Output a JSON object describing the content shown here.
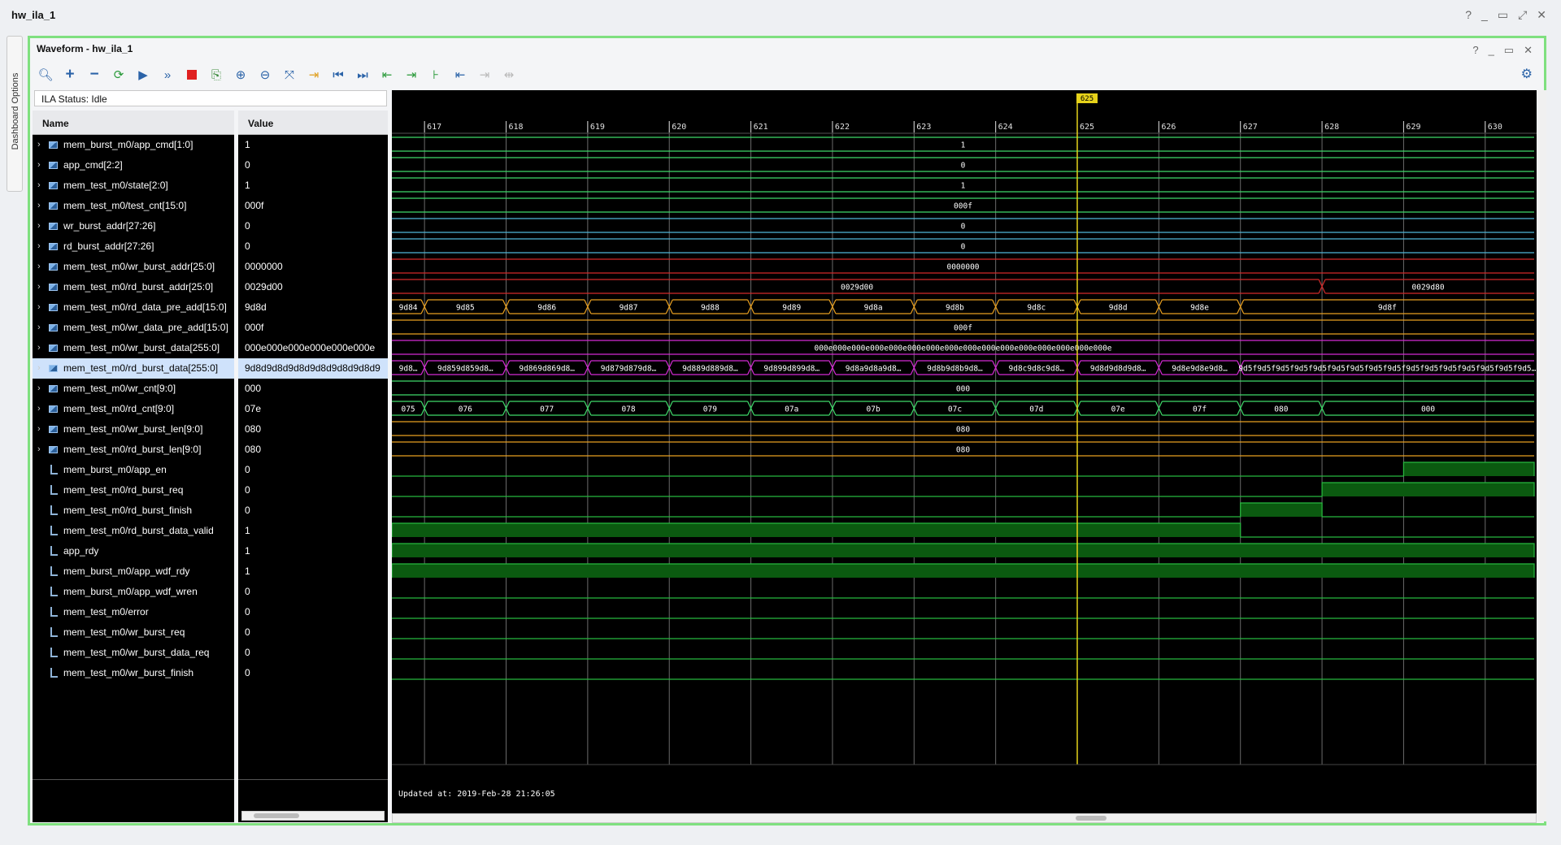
{
  "window": {
    "title": "hw_ila_1",
    "controls": [
      "?",
      "_",
      "▭",
      "⤢",
      "✕"
    ]
  },
  "dashboard_tab": "Dashboard Options",
  "panel": {
    "title": "Waveform - hw_ila_1",
    "controls": [
      "?",
      "_",
      "▭",
      "✕"
    ]
  },
  "status": "ILA Status:  Idle",
  "columns": {
    "name": "Name",
    "value": "Value"
  },
  "toolbar": [
    "search-icon",
    "add-icon",
    "remove-icon",
    "refresh-icon",
    "run-icon",
    "run-all-icon",
    "stop-icon",
    "export-icon",
    "zoom-in-icon",
    "zoom-out-icon",
    "zoom-fit-icon",
    "goto-cursor-icon",
    "goto-start-icon",
    "goto-end-icon",
    "prev-transition-icon",
    "next-transition-icon",
    "add-marker-icon",
    "prev-marker-icon",
    "next-marker-icon",
    "swap-cursor-icon"
  ],
  "cursor": {
    "time": 625,
    "label": "625"
  },
  "time_axis": {
    "ticks": [
      617,
      618,
      619,
      620,
      621,
      622,
      623,
      624,
      625,
      626,
      627,
      628,
      629,
      630
    ],
    "start": 616.6,
    "end": 630.6
  },
  "updated_text": "Updated at: 2019-Feb-28 21:26:05",
  "signals": [
    {
      "name": "mem_burst_m0/app_cmd[1:0]",
      "value": "1",
      "bus": true,
      "segments": [
        {
          "t": 616.6,
          "v": "1"
        }
      ],
      "color": "#3fd96a"
    },
    {
      "name": "app_cmd[2:2]",
      "value": "0",
      "bus": true,
      "segments": [
        {
          "t": 616.6,
          "v": "0"
        }
      ],
      "color": "#3fd96a"
    },
    {
      "name": "mem_test_m0/state[2:0]",
      "value": "1",
      "bus": true,
      "segments": [
        {
          "t": 616.6,
          "v": "1"
        }
      ],
      "color": "#3fd96a"
    },
    {
      "name": "mem_test_m0/test_cnt[15:0]",
      "value": "000f",
      "bus": true,
      "segments": [
        {
          "t": 616.6,
          "v": "000f"
        }
      ],
      "color": "#3fd96a"
    },
    {
      "name": "wr_burst_addr[27:26]",
      "value": "0",
      "bus": true,
      "segments": [
        {
          "t": 616.6,
          "v": "0"
        }
      ],
      "color": "#4fb6d8"
    },
    {
      "name": "rd_burst_addr[27:26]",
      "value": "0",
      "bus": true,
      "segments": [
        {
          "t": 616.6,
          "v": "0"
        }
      ],
      "color": "#4fb6d8"
    },
    {
      "name": "mem_test_m0/wr_burst_addr[25:0]",
      "value": "0000000",
      "bus": true,
      "segments": [
        {
          "t": 616.6,
          "v": "0000000"
        }
      ],
      "color": "#d22a2a"
    },
    {
      "name": "mem_test_m0/rd_burst_addr[25:0]",
      "value": "0029d00",
      "bus": true,
      "segments": [
        {
          "t": 616.6,
          "v": "0029d00"
        },
        {
          "t": 628,
          "v": "0029d80"
        }
      ],
      "color": "#d22a2a"
    },
    {
      "name": "mem_test_m0/rd_data_pre_add[15:0]",
      "value": "9d8d",
      "bus": true,
      "segments": [
        {
          "t": 616.6,
          "v": "9d84"
        },
        {
          "t": 617,
          "v": "9d85"
        },
        {
          "t": 618,
          "v": "9d86"
        },
        {
          "t": 619,
          "v": "9d87"
        },
        {
          "t": 620,
          "v": "9d88"
        },
        {
          "t": 621,
          "v": "9d89"
        },
        {
          "t": 622,
          "v": "9d8a"
        },
        {
          "t": 623,
          "v": "9d8b"
        },
        {
          "t": 624,
          "v": "9d8c"
        },
        {
          "t": 625,
          "v": "9d8d"
        },
        {
          "t": 626,
          "v": "9d8e"
        },
        {
          "t": 627,
          "v": "9d8f"
        }
      ],
      "color": "#e8a020"
    },
    {
      "name": "mem_test_m0/wr_data_pre_add[15:0]",
      "value": "000f",
      "bus": true,
      "segments": [
        {
          "t": 616.6,
          "v": "000f"
        }
      ],
      "color": "#e8a020"
    },
    {
      "name": "mem_test_m0/wr_burst_data[255:0]",
      "value": "000e000e000e000e000e000e",
      "bus": true,
      "segments": [
        {
          "t": 616.6,
          "v": "000e000e000e000e000e000e000e000e000e000e000e000e000e000e000e000e"
        }
      ],
      "color": "#d42bd4"
    },
    {
      "name": "mem_test_m0/rd_burst_data[255:0]",
      "value": "9d8d9d8d9d8d9d8d9d8d9d8d9",
      "bus": true,
      "selected": true,
      "segments": [
        {
          "t": 616.6,
          "v": "9d8…"
        },
        {
          "t": 617,
          "v": "9d859d859d8…"
        },
        {
          "t": 618,
          "v": "9d869d869d8…"
        },
        {
          "t": 619,
          "v": "9d879d879d8…"
        },
        {
          "t": 620,
          "v": "9d889d889d8…"
        },
        {
          "t": 621,
          "v": "9d899d899d8…"
        },
        {
          "t": 622,
          "v": "9d8a9d8a9d8…"
        },
        {
          "t": 623,
          "v": "9d8b9d8b9d8…"
        },
        {
          "t": 624,
          "v": "9d8c9d8c9d8…"
        },
        {
          "t": 625,
          "v": "9d8d9d8d9d8…"
        },
        {
          "t": 626,
          "v": "9d8e9d8e9d8…"
        },
        {
          "t": 627,
          "v": "9d5f9d5f9d5f9d5f9d5f9d5f9d5f9d5f9d5f9d5f9d5f9d5f9d5f9d5f9d5f9d5…"
        }
      ],
      "color": "#d42bd4"
    },
    {
      "name": "mem_test_m0/wr_cnt[9:0]",
      "value": "000",
      "bus": true,
      "segments": [
        {
          "t": 616.6,
          "v": "000"
        }
      ],
      "color": "#3fd96a"
    },
    {
      "name": "mem_test_m0/rd_cnt[9:0]",
      "value": "07e",
      "bus": true,
      "segments": [
        {
          "t": 616.6,
          "v": "075"
        },
        {
          "t": 617,
          "v": "076"
        },
        {
          "t": 618,
          "v": "077"
        },
        {
          "t": 619,
          "v": "078"
        },
        {
          "t": 620,
          "v": "079"
        },
        {
          "t": 621,
          "v": "07a"
        },
        {
          "t": 622,
          "v": "07b"
        },
        {
          "t": 623,
          "v": "07c"
        },
        {
          "t": 624,
          "v": "07d"
        },
        {
          "t": 625,
          "v": "07e"
        },
        {
          "t": 626,
          "v": "07f"
        },
        {
          "t": 627,
          "v": "080"
        },
        {
          "t": 628,
          "v": "000"
        }
      ],
      "color": "#3fd96a"
    },
    {
      "name": "mem_test_m0/wr_burst_len[9:0]",
      "value": "080",
      "bus": true,
      "segments": [
        {
          "t": 616.6,
          "v": "080"
        }
      ],
      "color": "#e8a020"
    },
    {
      "name": "mem_test_m0/rd_burst_len[9:0]",
      "value": "080",
      "bus": true,
      "segments": [
        {
          "t": 616.6,
          "v": "080"
        }
      ],
      "color": "#e8a020"
    },
    {
      "name": "mem_burst_m0/app_en",
      "value": "0",
      "bus": false,
      "high": [
        [
          629,
          630.6
        ]
      ]
    },
    {
      "name": "mem_test_m0/rd_burst_req",
      "value": "0",
      "bus": false,
      "high": [
        [
          628,
          630.6
        ]
      ]
    },
    {
      "name": "mem_test_m0/rd_burst_finish",
      "value": "0",
      "bus": false,
      "high": [
        [
          627,
          628
        ]
      ]
    },
    {
      "name": "mem_test_m0/rd_burst_data_valid",
      "value": "1",
      "bus": false,
      "high": [
        [
          616.6,
          627
        ]
      ]
    },
    {
      "name": "app_rdy",
      "value": "1",
      "bus": false,
      "high": [
        [
          616.6,
          630.6
        ]
      ]
    },
    {
      "name": "mem_burst_m0/app_wdf_rdy",
      "value": "1",
      "bus": false,
      "high": [
        [
          616.6,
          630.6
        ]
      ]
    },
    {
      "name": "mem_burst_m0/app_wdf_wren",
      "value": "0",
      "bus": false,
      "high": []
    },
    {
      "name": "mem_test_m0/error",
      "value": "0",
      "bus": false,
      "high": []
    },
    {
      "name": "mem_test_m0/wr_burst_req",
      "value": "0",
      "bus": false,
      "high": []
    },
    {
      "name": "mem_test_m0/wr_burst_data_req",
      "value": "0",
      "bus": false,
      "high": []
    },
    {
      "name": "mem_test_m0/wr_burst_finish",
      "value": "0",
      "bus": false,
      "high": []
    }
  ]
}
